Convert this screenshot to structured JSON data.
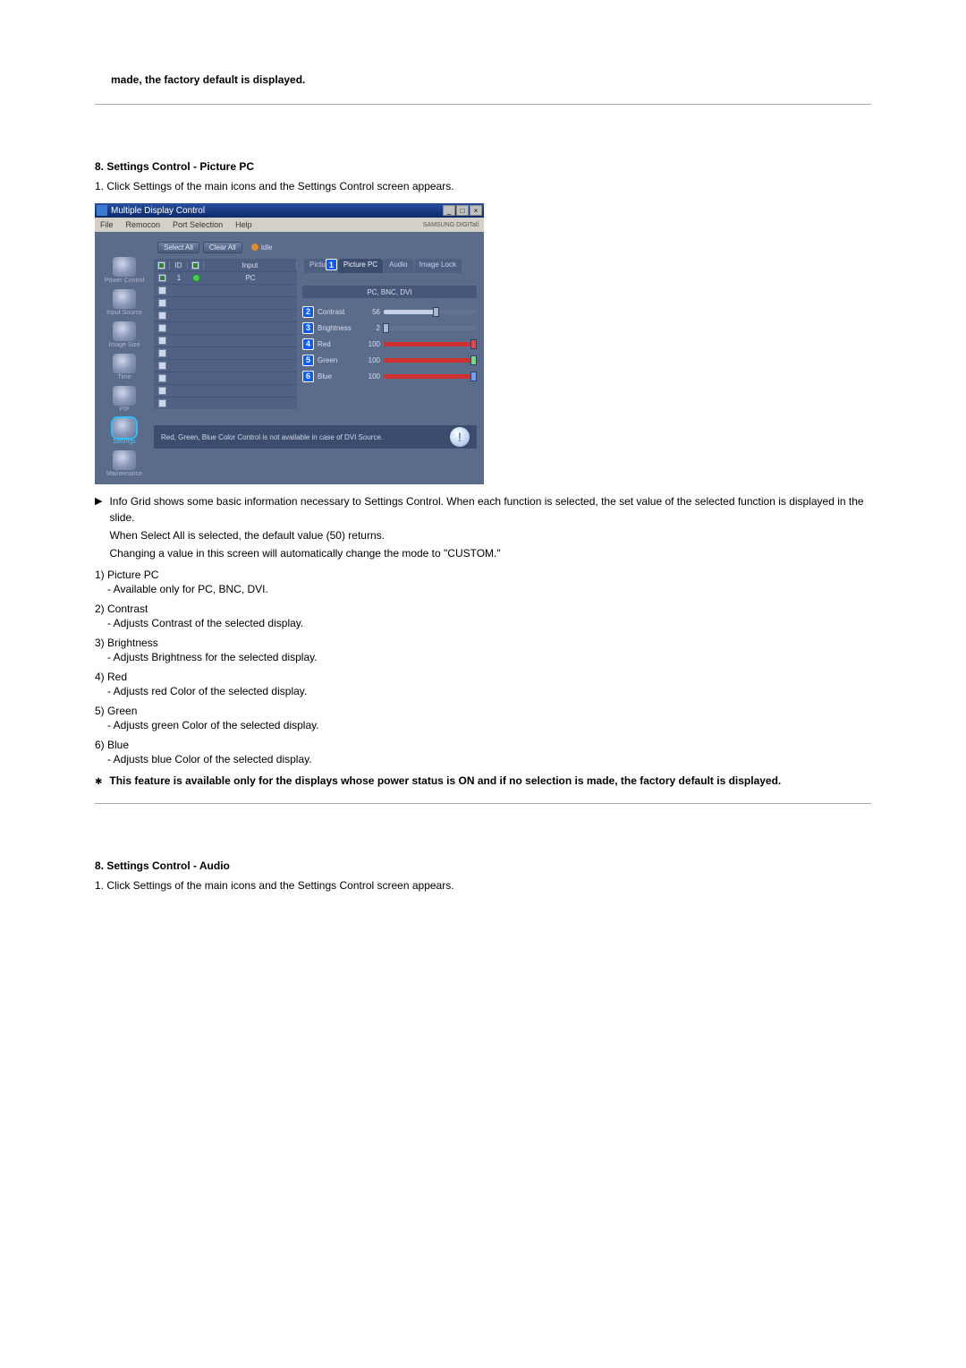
{
  "top_note": "made, the factory default is displayed.",
  "section1": {
    "heading": "8. Settings Control - Picture PC",
    "step1": "1.  Click Settings of the main icons and the Settings Control screen appears."
  },
  "app": {
    "title": "Multiple Display Control",
    "menu": [
      "File",
      "Remocon",
      "Port Selection",
      "Help"
    ],
    "brand": "SAMSUNG DIGITall",
    "btn_select_all": "Select All",
    "btn_clear_all": "Clear All",
    "idle": "Idle",
    "sidebar": [
      {
        "label": "Power Control"
      },
      {
        "label": "Input Source"
      },
      {
        "label": "Image Size"
      },
      {
        "label": "Time"
      },
      {
        "label": "PIP"
      },
      {
        "label": "Settings"
      },
      {
        "label": "Maintenance"
      }
    ],
    "grid": {
      "headers": [
        "",
        "ID",
        "",
        "Input"
      ],
      "row": {
        "id": "1",
        "input": "PC"
      }
    },
    "tabs": [
      "Picture",
      "Picture PC",
      "Audio",
      "Image Lock"
    ],
    "sub_header": "PC, BNC, DVI",
    "sliders": [
      {
        "num": "2",
        "label": "Contrast",
        "value": "56",
        "pct": 56,
        "color": "default"
      },
      {
        "num": "3",
        "label": "Brightness",
        "value": "2",
        "pct": 2,
        "color": "default"
      },
      {
        "num": "4",
        "label": "Red",
        "value": "100",
        "pct": 100,
        "color": "red"
      },
      {
        "num": "5",
        "label": "Green",
        "value": "100",
        "pct": 100,
        "color": "green"
      },
      {
        "num": "6",
        "label": "Blue",
        "value": "100",
        "pct": 100,
        "color": "blue"
      }
    ],
    "footer_note": "Red, Green, Blue Color Control is not available in case of DVI Source."
  },
  "info_block": {
    "line1": "Info Grid shows some basic information necessary to Settings Control. When each function is selected, the set value of the selected function is displayed in the slide.",
    "line2": "When Select All is selected, the default value (50) returns.",
    "line3": "Changing a value in this screen will automatically change the mode to \"CUSTOM.\""
  },
  "items": [
    {
      "num": "1)",
      "title": "Picture PC",
      "desc": "- Available only for PC, BNC, DVI."
    },
    {
      "num": "2)",
      "title": "Contrast",
      "desc": "- Adjusts Contrast of the selected display."
    },
    {
      "num": "3)",
      "title": "Brightness",
      "desc": "- Adjusts Brightness for the selected display."
    },
    {
      "num": "4)",
      "title": "Red",
      "desc": "- Adjusts red Color of the selected display."
    },
    {
      "num": "5)",
      "title": "Green",
      "desc": "- Adjusts green Color of the selected display."
    },
    {
      "num": "6)",
      "title": "Blue",
      "desc": "- Adjusts blue Color of the selected display."
    }
  ],
  "bottom_note": "This feature is available only for the displays whose power status is ON and if no selection is made, the factory default is displayed.",
  "section2": {
    "heading": "8. Settings Control - Audio",
    "step1": "1.  Click Settings of the main icons and the Settings Control screen appears."
  }
}
